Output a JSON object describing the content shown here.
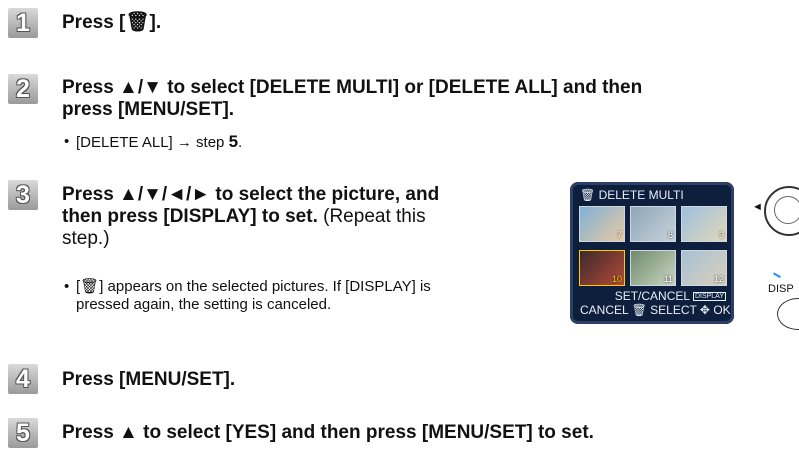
{
  "steps": [
    {
      "number": "1",
      "heading": "Press [🗑]."
    },
    {
      "number": "2",
      "heading_line1": "Press ▲/▼ to select [DELETE MULTI] or [DELETE ALL] and then",
      "heading_line2": "press [MENU/SET].",
      "note_text": "[DELETE ALL] → step ",
      "note_step": "5",
      "note_tail": "."
    },
    {
      "number": "3",
      "heading_line1_bold": "Press ▲/▼/◄/► to select the picture, and",
      "heading_line2_bold": "then press [DISPLAY] to set.",
      "heading_line2_normal": " (Repeat this",
      "heading_line3_normal": "step.)",
      "note_line1": "[🗑] appears on the selected pictures. If [DISPLAY] is",
      "note_line2": "pressed again, the setting is canceled."
    },
    {
      "number": "4",
      "heading": "Press [MENU/SET]."
    },
    {
      "number": "5",
      "heading": "Press ▲ to select [YES] and then press [MENU/SET] to set."
    }
  ],
  "bullet": "•",
  "screen": {
    "title": "🗑 DELETE MULTI",
    "thumbnails": [
      "7",
      "8",
      "9",
      "10",
      "11",
      "12"
    ],
    "set_cancel": "SET/CANCEL",
    "display_tag": "DISPLAY",
    "footer": "CANCEL 🗑 SELECT ✥ OK"
  },
  "side": {
    "arrow": "◄",
    "display_label": "DISP"
  },
  "colors": {
    "badge": "#9a9a9a",
    "screen_bg": "#0d1f3c",
    "selected_thumb": "#ffcc00"
  }
}
